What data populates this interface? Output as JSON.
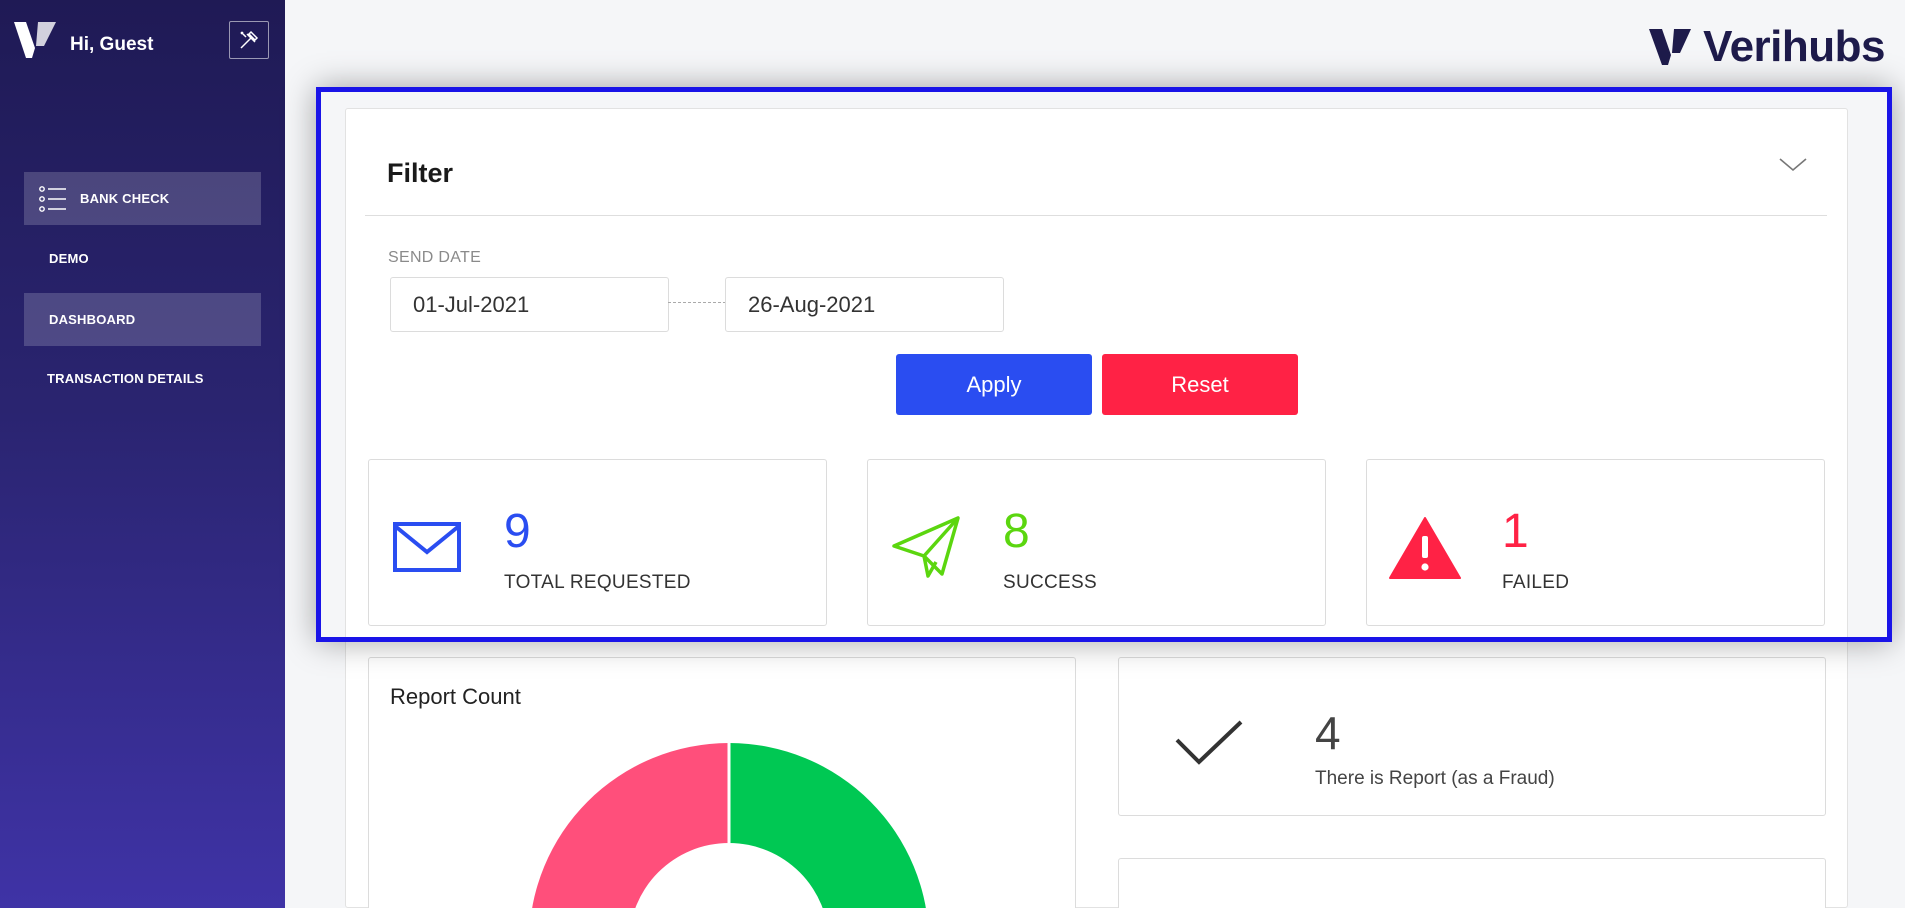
{
  "sidebar": {
    "greeting": "Hi, Guest",
    "items": [
      {
        "label": "BANK CHECK"
      },
      {
        "label": "DEMO"
      },
      {
        "label": "DASHBOARD"
      },
      {
        "label": "TRANSACTION DETAILS"
      }
    ]
  },
  "header": {
    "brand": "Verihubs"
  },
  "filter": {
    "title": "Filter",
    "send_date_label": "SEND DATE",
    "start_date": "01-Jul-2021",
    "end_date": "26-Aug-2021",
    "apply_label": "Apply",
    "reset_label": "Reset"
  },
  "stats": [
    {
      "value": "9",
      "label": "TOTAL REQUESTED",
      "color": "#2a4df1",
      "icon": "envelope-icon"
    },
    {
      "value": "8",
      "label": "SUCCESS",
      "color": "#5bd60f",
      "icon": "paper-plane-icon"
    },
    {
      "value": "1",
      "label": "FAILED",
      "color": "#ff2245",
      "icon": "warning-icon"
    }
  ],
  "report": {
    "title": "Report Count",
    "colors": {
      "fraud": "#ff4f7b",
      "ok": "#00c853"
    }
  },
  "fraud_stat": {
    "value": "4",
    "label": "There is Report (as a Fraud)",
    "icon": "checkmark-icon"
  },
  "colors": {
    "sidebar_top": "#1f1a55",
    "sidebar_bottom": "#3f33a6",
    "brand": "#1e1b4b",
    "highlight": "#1a14e8"
  }
}
